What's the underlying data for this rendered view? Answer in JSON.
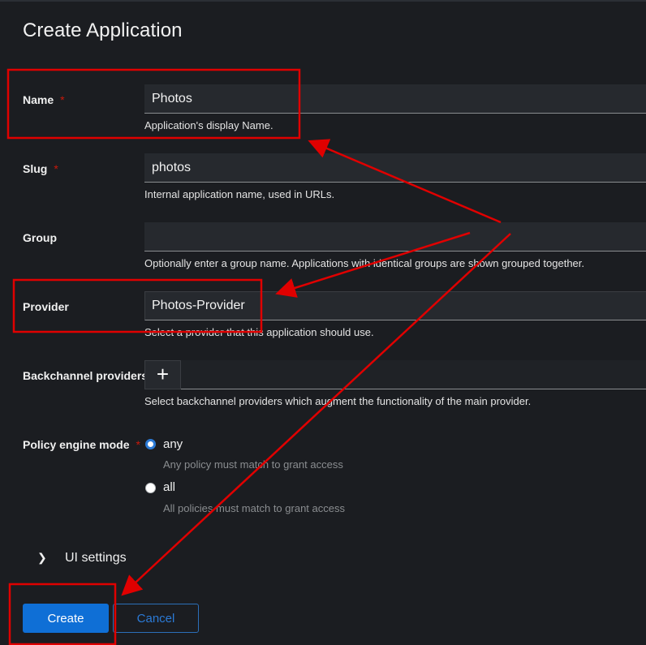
{
  "title": "Create Application",
  "fields": {
    "name": {
      "label": "Name",
      "required": "*",
      "value": "Photos",
      "helper": "Application's display Name."
    },
    "slug": {
      "label": "Slug",
      "required": "*",
      "value": "photos",
      "helper": "Internal application name, used in URLs."
    },
    "group": {
      "label": "Group",
      "value": "",
      "helper": "Optionally enter a group name. Applications with identical groups are shown grouped together."
    },
    "provider": {
      "label": "Provider",
      "value": "Photos-Provider",
      "helper": "Select a provider that this application should use."
    },
    "backchannel": {
      "label": "Backchannel providers",
      "add_symbol": "+",
      "helper": "Select backchannel providers which augment the functionality of the main provider."
    },
    "policy": {
      "label": "Policy engine mode",
      "required": "*",
      "options": [
        {
          "label": "any",
          "desc": "Any policy must match to grant access",
          "selected": true
        },
        {
          "label": "all",
          "desc": "All policies must match to grant access",
          "selected": false
        }
      ]
    }
  },
  "ui_settings": {
    "label": "UI settings"
  },
  "actions": {
    "create": "Create",
    "cancel": "Cancel"
  },
  "annotation_color": "#e00000",
  "accent_color": "#0f6fd6"
}
